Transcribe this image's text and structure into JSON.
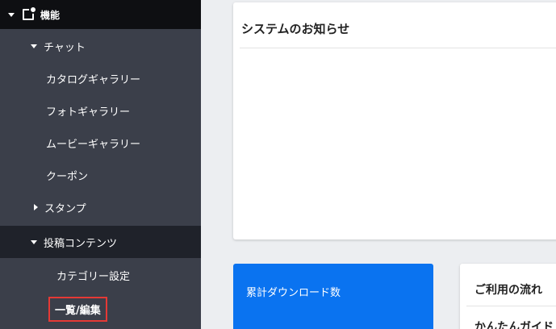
{
  "sidebar": {
    "section_label": "機能",
    "chat_label": "チャット",
    "chat_items": [
      "カタログギャラリー",
      "フォトギャラリー",
      "ムービーギャラリー",
      "クーポン"
    ],
    "stamp_label": "スタンプ",
    "posts_label": "投稿コンテンツ",
    "category_label": "カテゴリー設定",
    "list_edit_label": "一覧/編集"
  },
  "main": {
    "notice_title": "システムのお知らせ",
    "downloads_label": "累計ダウンロード数",
    "flow_title": "ご利用の流れ",
    "flow_subtitle": "かんたんガイド"
  },
  "colors": {
    "sidebar_bg": "#3b3f4a",
    "sidebar_top": "#0e0f12",
    "accent_blue": "#0a73f0",
    "highlight_red": "#e53935"
  }
}
